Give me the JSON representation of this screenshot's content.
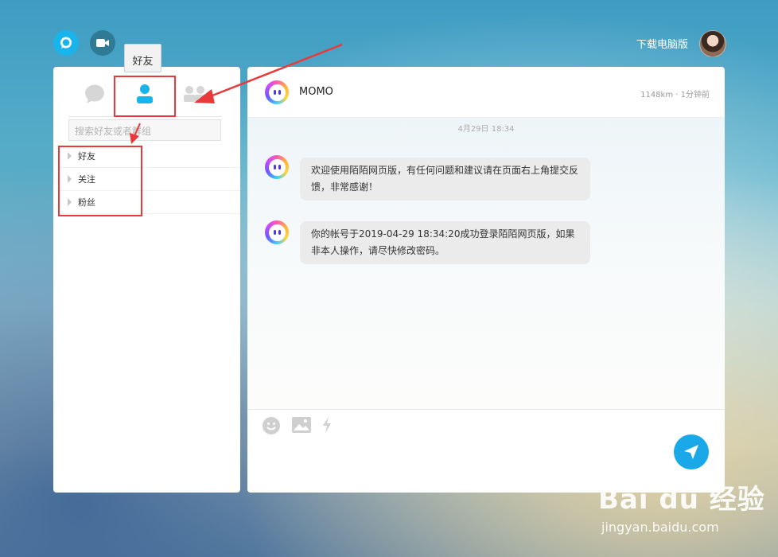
{
  "topbar": {
    "download_label": "下载电脑版"
  },
  "tooltip": {
    "text": "好友"
  },
  "left_panel": {
    "search_placeholder": "搜索好友或者群组",
    "groups": [
      {
        "label": "好友"
      },
      {
        "label": "关注"
      },
      {
        "label": "粉丝"
      }
    ]
  },
  "chat": {
    "title": "MOMO",
    "meta": "1148km · 1分钟前",
    "timestamp": "4月29日 18:34",
    "messages": [
      {
        "text": "欢迎使用陌陌网页版，有任何问题和建议请在页面右上角提交反馈，非常感谢！"
      },
      {
        "text": "你的帐号于2019-04-29 18:34:20成功登录陌陌网页版，如果非本人操作，请尽快修改密码。"
      }
    ]
  },
  "colors": {
    "accent": "#19b4ec",
    "annotation": "#e83a3a"
  },
  "watermark": {
    "logo": "Bai du 经验",
    "url": "jingyan.baidu.com"
  }
}
